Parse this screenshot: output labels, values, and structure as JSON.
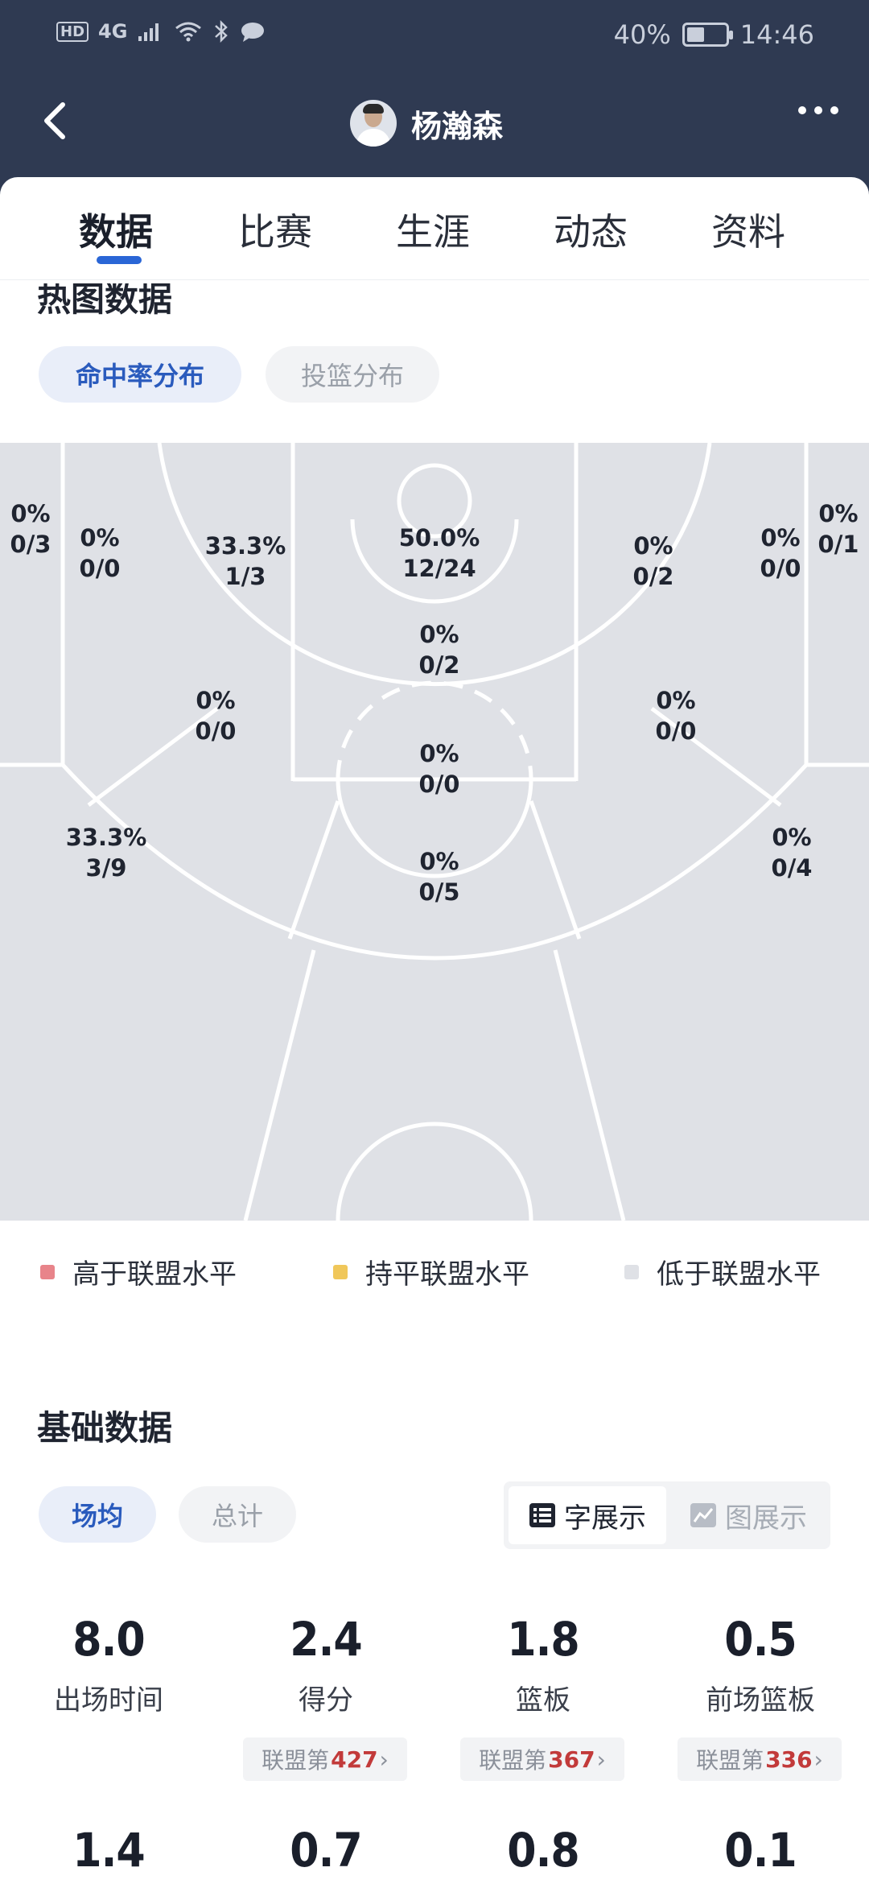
{
  "status_bar": {
    "left_indicators": [
      "HD",
      "4G"
    ],
    "battery": "40%",
    "battery_level": 0.4,
    "time": "14:46"
  },
  "header": {
    "player_name": "杨瀚森"
  },
  "tabs": [
    {
      "label": "数据",
      "active": true
    },
    {
      "label": "比赛",
      "active": false
    },
    {
      "label": "生涯",
      "active": false
    },
    {
      "label": "动态",
      "active": false
    },
    {
      "label": "资料",
      "active": false
    }
  ],
  "heatmap": {
    "title": "热图数据",
    "toggles": [
      {
        "label": "命中率分布",
        "active": true
      },
      {
        "label": "投篮分布",
        "active": false
      }
    ],
    "zones": [
      {
        "pct": "0%",
        "att": "0/3"
      },
      {
        "pct": "0%",
        "att": "0/0"
      },
      {
        "pct": "33.3%",
        "att": "1/3"
      },
      {
        "pct": "50.0%",
        "att": "12/24"
      },
      {
        "pct": "0%",
        "att": "0/2"
      },
      {
        "pct": "0%",
        "att": "0/0"
      },
      {
        "pct": "0%",
        "att": "0/1"
      },
      {
        "pct": "0%",
        "att": "0/2"
      },
      {
        "pct": "0%",
        "att": "0/0"
      },
      {
        "pct": "0%",
        "att": "0/0"
      },
      {
        "pct": "0%",
        "att": "0/0"
      },
      {
        "pct": "33.3%",
        "att": "3/9"
      },
      {
        "pct": "0%",
        "att": "0/5"
      },
      {
        "pct": "0%",
        "att": "0/4"
      }
    ],
    "legend": [
      {
        "label": "高于联盟水平",
        "color": "#e8848a"
      },
      {
        "label": "持平联盟水平",
        "color": "#f0c75a"
      },
      {
        "label": "低于联盟水平",
        "color": "#dfe1e6"
      }
    ],
    "court_fill": "#dfe1e6",
    "court_line": "#ffffff"
  },
  "basic": {
    "title": "基础数据",
    "toggles": [
      {
        "label": "场均",
        "active": true
      },
      {
        "label": "总计",
        "active": false
      }
    ],
    "view_toggle": {
      "text_view": "字展示",
      "chart_view": "图展示"
    },
    "stats_row1": [
      {
        "value": "8.0",
        "label": "出场时间"
      },
      {
        "value": "2.4",
        "label": "得分",
        "rank_prefix": "联盟第",
        "rank": "427"
      },
      {
        "value": "1.8",
        "label": "篮板",
        "rank_prefix": "联盟第",
        "rank": "367"
      },
      {
        "value": "0.5",
        "label": "前场篮板",
        "rank_prefix": "联盟第",
        "rank": "336"
      }
    ],
    "stats_row2": [
      {
        "value": "1.4"
      },
      {
        "value": "0.7"
      },
      {
        "value": "0.8"
      },
      {
        "value": "0.1"
      }
    ],
    "accent": "#2a66d6",
    "rank_color": "#c23a3a"
  }
}
